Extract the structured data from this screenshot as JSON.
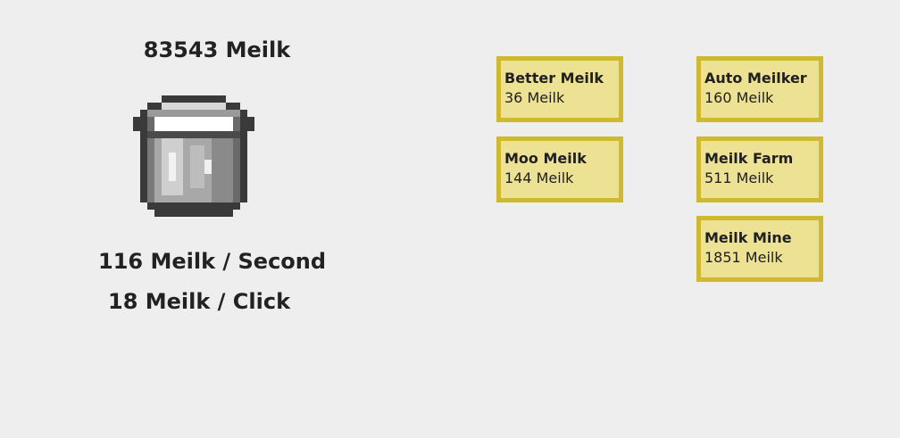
{
  "counter": {
    "total_label": "83543 Meilk",
    "per_second_label": "116 Meilk / Second",
    "per_click_label": "18 Meilk / Click"
  },
  "clicker": {
    "icon": "milk-bucket-icon"
  },
  "upgrades": [
    {
      "name": "Better Meilk",
      "cost": "36 Meilk"
    },
    {
      "name": "Moo Meilk",
      "cost": "144 Meilk"
    },
    {
      "name": "Auto Meilker",
      "cost": "160 Meilk"
    },
    {
      "name": "Meilk Farm",
      "cost": "511 Meilk"
    },
    {
      "name": "Meilk Mine",
      "cost": "1851 Meilk"
    }
  ],
  "colors": {
    "background": "#eeeeee",
    "upgrade_fill": "#ede293",
    "upgrade_border": "#cfb92e"
  }
}
